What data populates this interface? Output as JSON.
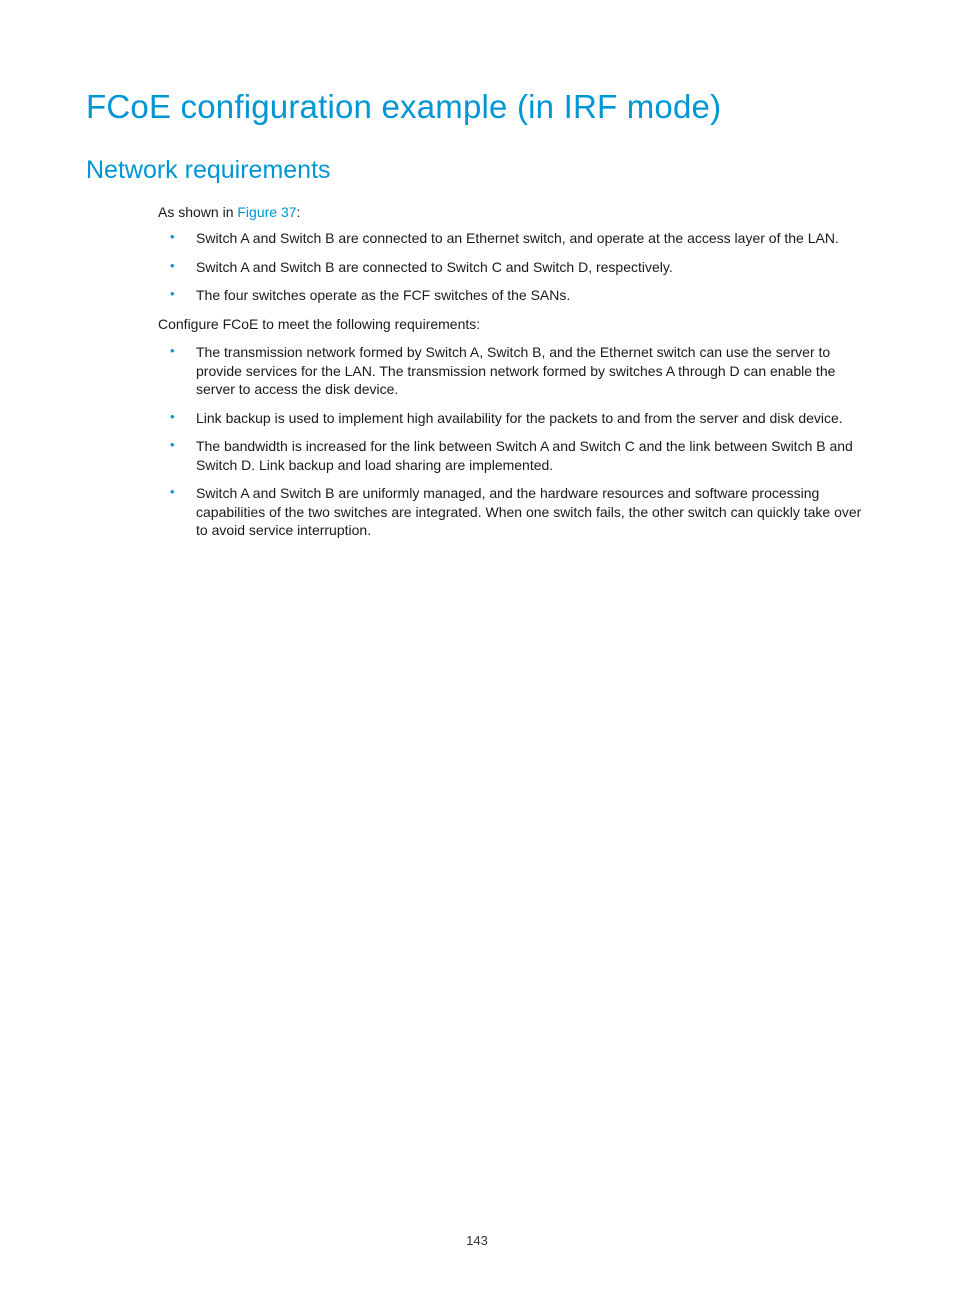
{
  "title": "FCoE configuration example (in IRF mode)",
  "section": "Network requirements",
  "intro_prefix": "As shown in ",
  "intro_link": "Figure 37",
  "intro_suffix": ":",
  "list1": [
    "Switch A and Switch B are connected to an Ethernet switch, and operate at the access layer of the LAN.",
    "Switch A and Switch B are connected to Switch C and Switch D, respectively.",
    "The four switches operate as the FCF switches of the SANs."
  ],
  "lead": "Configure FCoE to meet the following requirements:",
  "list2": [
    "The transmission network formed by Switch A, Switch B, and the Ethernet switch can use the server to provide services for the LAN. The transmission network formed by switches A through D can enable the server to access the disk device.",
    "Link backup is used to implement high availability for the packets to and from the server and disk device.",
    "The bandwidth is increased for the link between Switch A and Switch C and the link between Switch B and Switch D. Link backup and load sharing are implemented.",
    "Switch A and Switch B are uniformly managed, and the hardware resources and software processing capabilities of the two switches are integrated. When one switch fails, the other switch can quickly take over to avoid service interruption."
  ],
  "page_number": "143"
}
